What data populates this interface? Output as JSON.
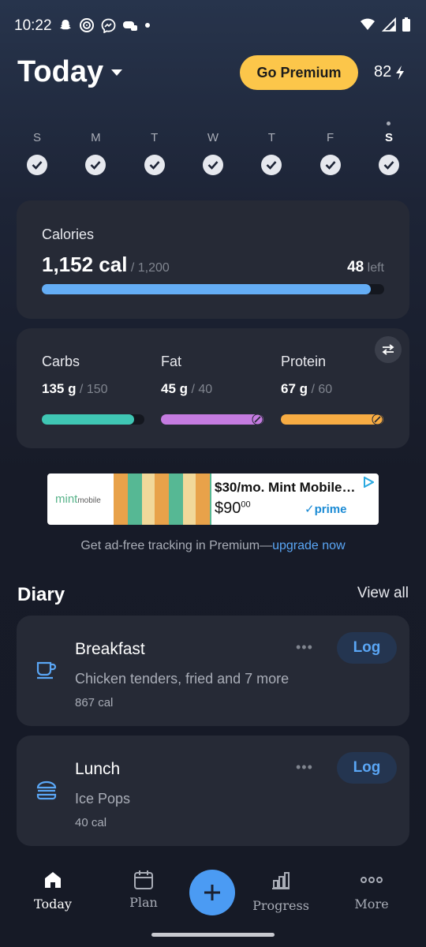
{
  "status": {
    "time": "10:22"
  },
  "header": {
    "title": "Today",
    "premium_label": "Go Premium",
    "streak_count": "82"
  },
  "week": [
    {
      "letter": "S",
      "done": true
    },
    {
      "letter": "M",
      "done": true
    },
    {
      "letter": "T",
      "done": true
    },
    {
      "letter": "W",
      "done": true
    },
    {
      "letter": "T",
      "done": true
    },
    {
      "letter": "F",
      "done": true
    },
    {
      "letter": "S",
      "done": true,
      "today": true
    }
  ],
  "calories": {
    "label": "Calories",
    "value": "1,152 cal",
    "goal": " / 1,200",
    "left_value": "48",
    "left_unit": " left",
    "progress": 0.96,
    "color": "#64adf5"
  },
  "macros": [
    {
      "name": "Carbs",
      "value": "135 g",
      "goal": " / 150",
      "progress": 0.9,
      "color": "#3fc6b4",
      "over": false
    },
    {
      "name": "Fat",
      "value": "45 g",
      "goal": " / 40",
      "progress": 1.0,
      "color": "#c47be0",
      "over": true
    },
    {
      "name": "Protein",
      "value": "67 g",
      "goal": " / 60",
      "progress": 1.0,
      "color": "#f7ac43",
      "over": true
    }
  ],
  "ad": {
    "brand": "mint",
    "brand_suffix": "mobile",
    "headline": "$30/mo. Mint Mobile…",
    "price": "$9000",
    "prime": "prime"
  },
  "upsell": {
    "text": "Get ad-free tracking in Premium—",
    "link": "upgrade now"
  },
  "diary": {
    "title": "Diary",
    "view_all": "View all",
    "meals": [
      {
        "name": "Breakfast",
        "desc": "Chicken tenders, fried and 7 more",
        "cal": "867 cal",
        "log": "Log",
        "icon": "coffee-cup-icon"
      },
      {
        "name": "Lunch",
        "desc": "Ice Pops",
        "cal": "40 cal",
        "log": "Log",
        "icon": "burger-icon"
      }
    ]
  },
  "nav": {
    "today": "Today",
    "plan": "Plan",
    "progress": "Progress",
    "more": "More"
  }
}
